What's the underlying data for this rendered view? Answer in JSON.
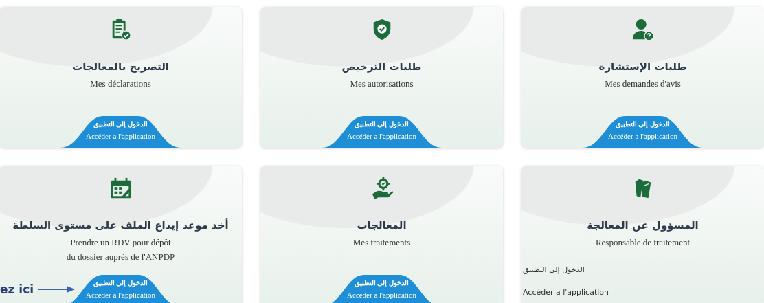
{
  "cards": [
    {
      "title": "طلبات الإستشارة",
      "subtitle": [
        "Mes demandes d'avis"
      ],
      "button": {
        "kind": "shaped",
        "label_ar": "الدخول إلى التطبيق",
        "label_fr": "Accéder a l'application"
      }
    },
    {
      "title": "طلبات الترخيص",
      "subtitle": [
        "Mes autorisations"
      ],
      "button": {
        "kind": "shaped",
        "label_ar": "الدخول إلى التطبيق",
        "label_fr": "Accéder a l'application"
      }
    },
    {
      "title": "التصريح بالمعالجات",
      "subtitle": [
        "Mes déclarations"
      ],
      "button": {
        "kind": "shaped",
        "label_ar": "الدخول إلى التطبيق",
        "label_fr": "Accéder a l'application"
      }
    },
    {
      "title": "المسؤول عن المعالجة",
      "subtitle": [
        "Responsable de traitement"
      ],
      "button": {
        "kind": "plain",
        "label_ar": "الدخول إلى التطبيق",
        "label_fr": "Accéder a l'application"
      }
    },
    {
      "title": "المعالجات",
      "subtitle": [
        "Mes traitements"
      ],
      "button": {
        "kind": "shaped",
        "label_ar": "الدخول إلى التطبيق",
        "label_fr": "Accéder a l'application"
      }
    },
    {
      "title": "أخذ موعد إيداع الملف على مستوى السلطة",
      "subtitle": [
        "Prendre un RDV pour dépôt",
        "du dossier auprès de l'ANPDP"
      ],
      "button": {
        "kind": "shaped",
        "label_ar": "الدخول إلى التطبيق",
        "label_fr": "Accéder a l'application"
      }
    }
  ],
  "annotation": {
    "text": "ez ici"
  }
}
